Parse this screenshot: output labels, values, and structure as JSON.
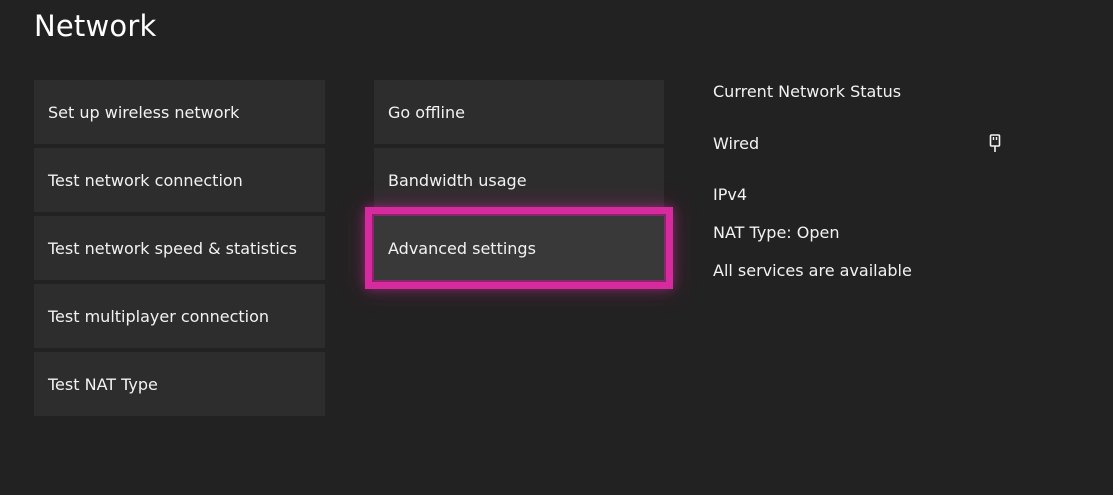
{
  "page": {
    "title": "Network"
  },
  "menu_left": [
    {
      "label": "Set up wireless network"
    },
    {
      "label": "Test network connection"
    },
    {
      "label": "Test network speed & statistics"
    },
    {
      "label": "Test multiplayer connection"
    },
    {
      "label": "Test NAT Type"
    }
  ],
  "menu_middle": [
    {
      "label": "Go offline"
    },
    {
      "label": "Bandwidth usage"
    },
    {
      "label": "Advanced settings",
      "focused": true
    }
  ],
  "status": {
    "heading": "Current Network Status",
    "connection": "Wired",
    "connection_icon": "ethernet-plug-icon",
    "ip_version": "IPv4",
    "nat_type": "NAT Type: Open",
    "services": "All services are available"
  },
  "colors": {
    "background": "#232222",
    "tile": "#2e2d2d",
    "focus_highlight": "#d62a9f"
  }
}
